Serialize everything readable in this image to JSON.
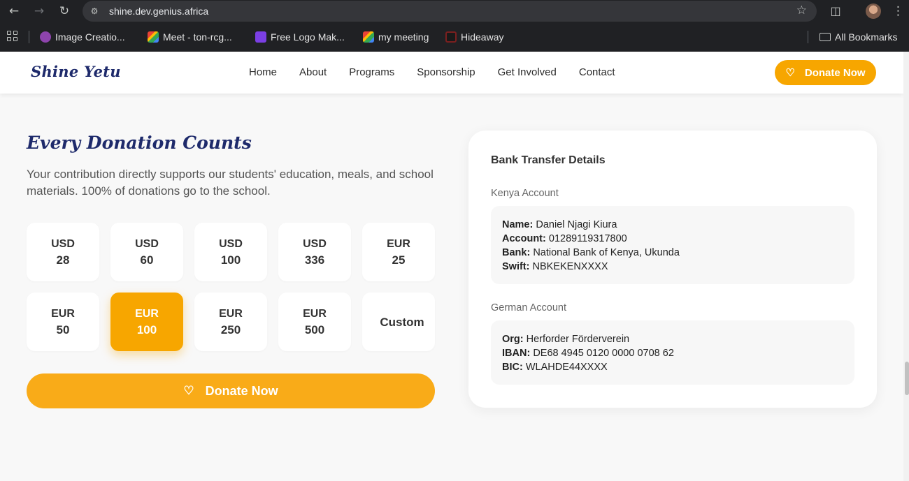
{
  "browser": {
    "url": "shine.dev.genius.africa",
    "bookmarks": [
      {
        "label": "Image Creatio...",
        "color": "#8e44ad"
      },
      {
        "label": "Meet - ton-rcg...",
        "color": "#34a853"
      },
      {
        "label": "Free Logo Mak...",
        "color": "#7b3fe4"
      },
      {
        "label": "my meeting",
        "color": "#34a853"
      },
      {
        "label": "Hideaway",
        "color": "#7a1f1f"
      }
    ],
    "all_bookmarks": "All Bookmarks"
  },
  "site": {
    "logo": "Shine Yetu",
    "nav": [
      "Home",
      "About",
      "Programs",
      "Sponsorship",
      "Get Involved",
      "Contact"
    ],
    "header_donate": "Donate Now"
  },
  "donation": {
    "heading": "Every Donation Counts",
    "description": "Your contribution directly supports our students' education, meals, and school materials. 100% of donations go to the school.",
    "amounts": [
      {
        "currency": "USD",
        "value": "28"
      },
      {
        "currency": "USD",
        "value": "60"
      },
      {
        "currency": "USD",
        "value": "100"
      },
      {
        "currency": "USD",
        "value": "336"
      },
      {
        "currency": "EUR",
        "value": "25"
      },
      {
        "currency": "EUR",
        "value": "50"
      },
      {
        "currency": "EUR",
        "value": "100",
        "selected": true
      },
      {
        "currency": "EUR",
        "value": "250"
      },
      {
        "currency": "EUR",
        "value": "500"
      },
      {
        "currency": "",
        "value": "Custom"
      }
    ],
    "donate_button": "Donate Now",
    "accent_color": "#f7a600"
  },
  "bank": {
    "title": "Bank Transfer Details",
    "kenya": {
      "label": "Kenya Account",
      "name_label": "Name:",
      "name": "Daniel Njagi Kiura",
      "account_label": "Account:",
      "account": "01289119317800",
      "bank_label": "Bank:",
      "bank": "National Bank of Kenya, Ukunda",
      "swift_label": "Swift:",
      "swift": "NBKEKENXXXX"
    },
    "germany": {
      "label": "German Account",
      "org_label": "Org:",
      "org": "Herforder Förderverein",
      "iban_label": "IBAN:",
      "iban": "DE68 4945 0120 0000 0708 62",
      "bic_label": "BIC:",
      "bic": "WLAHDE44XXXX"
    }
  }
}
